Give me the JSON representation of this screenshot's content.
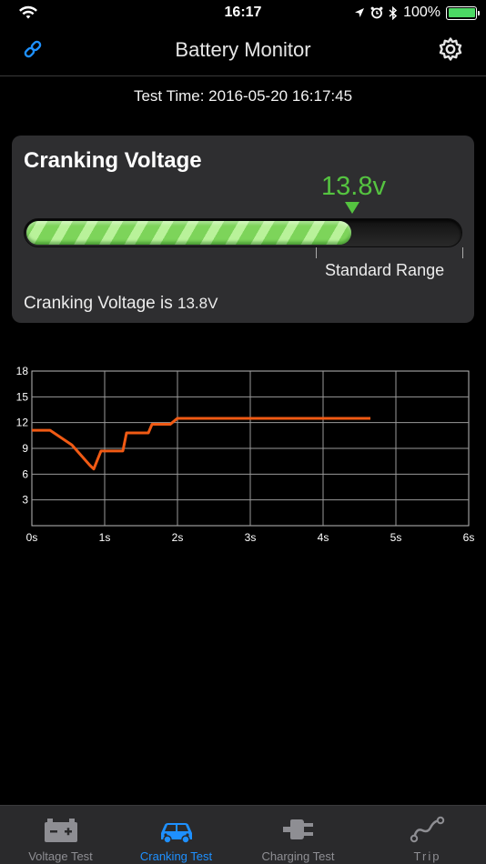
{
  "status_bar": {
    "time": "16:17",
    "battery_percent": "100%",
    "battery_level": 1.0
  },
  "nav": {
    "title": "Battery Monitor"
  },
  "test_time": {
    "label": "Test Time:",
    "value": "2016-05-20 16:17:45"
  },
  "card": {
    "title": "Cranking Voltage",
    "reading": "13.8v",
    "bar_level": 0.75,
    "range_label": "Standard Range",
    "result_prefix": "Cranking Voltage is",
    "result_value": "13.8V"
  },
  "colors": {
    "accent_green": "#55c340",
    "line_orange": "#f05a14",
    "tab_active": "#1e90ff",
    "tab_inactive": "#8e8e93"
  },
  "chart_data": {
    "type": "line",
    "title": "",
    "xlabel": "",
    "ylabel": "",
    "xlim": [
      0,
      6
    ],
    "ylim": [
      0,
      18
    ],
    "xticks": [
      "0s",
      "1s",
      "2s",
      "3s",
      "4s",
      "5s",
      "6s"
    ],
    "yticks": [
      "3",
      "6",
      "9",
      "12",
      "15",
      "18"
    ],
    "grid": true,
    "series": [
      {
        "color": "#f05a14",
        "x": [
          0,
          0.25,
          0.55,
          0.8,
          0.85,
          0.95,
          1.15,
          1.25,
          1.3,
          1.6,
          1.65,
          1.9,
          2.0,
          2.1,
          2.5,
          3.0,
          3.5,
          4.0,
          4.5,
          4.65
        ],
        "y": [
          11.1,
          11.1,
          9.4,
          7.0,
          6.6,
          8.7,
          8.7,
          8.7,
          10.8,
          10.8,
          11.8,
          11.8,
          12.5,
          12.5,
          12.5,
          12.5,
          12.5,
          12.5,
          12.5,
          12.5
        ]
      }
    ]
  },
  "tabs": [
    {
      "label": "Voltage Test",
      "icon": "battery-icon",
      "active": false
    },
    {
      "label": "Cranking Test",
      "icon": "car-icon",
      "active": true
    },
    {
      "label": "Charging Test",
      "icon": "plug-icon",
      "active": false
    },
    {
      "label": "Trip",
      "icon": "trip-route-icon",
      "active": false
    }
  ]
}
